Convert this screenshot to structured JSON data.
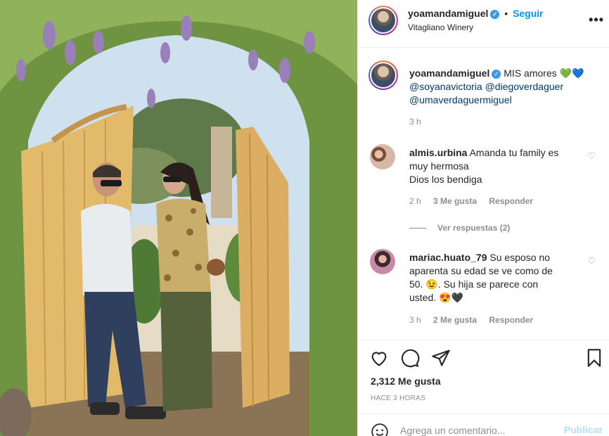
{
  "post": {
    "username": "yoamandamiguel",
    "separator": "•",
    "follow_label": "Seguir",
    "location": "Vitagliano Winery",
    "more_icon": "more-options-icon"
  },
  "caption": {
    "username": "yoamandamiguel",
    "text": "MIS amores",
    "hearts": [
      "💚",
      "💙"
    ],
    "mentions": [
      "@soyanavictoria",
      "@diegoverdaguer",
      "@umaverdaguermiguel"
    ],
    "time": "3 h"
  },
  "comments": [
    {
      "username": "almis.urbina",
      "text_line1": "Amanda tu family es",
      "text_line2": "muy hermosa",
      "text_line3": "Dios los bendiga",
      "time": "2 h",
      "likes": "3 Me gusta",
      "reply_label": "Responder",
      "view_replies": "Ver respuestas (2)"
    },
    {
      "username": "mariac.huato_79",
      "text_line1": "Su esposo no",
      "text_line2": "aparenta su edad se ve como de",
      "text_line3": "50. 😉. Su hija se parece con",
      "text_line4": "usted. 😍🖤",
      "time": "3 h",
      "likes": "2 Me gusta",
      "reply_label": "Responder"
    }
  ],
  "actions": {
    "icons": [
      "heart-icon",
      "comment-icon",
      "share-icon",
      "bookmark-icon"
    ]
  },
  "likes_count": "2,312 Me gusta",
  "posted_ago": "HACE 3 HORAS",
  "add_comment": {
    "placeholder": "Agrega un comentario...",
    "post_label": "Publicar"
  },
  "colors": {
    "link_blue": "#0095f6",
    "mention_blue": "#00376b",
    "muted_gray": "#8e8e8e",
    "text": "#262626",
    "disabled_blue": "#b2dffc"
  }
}
